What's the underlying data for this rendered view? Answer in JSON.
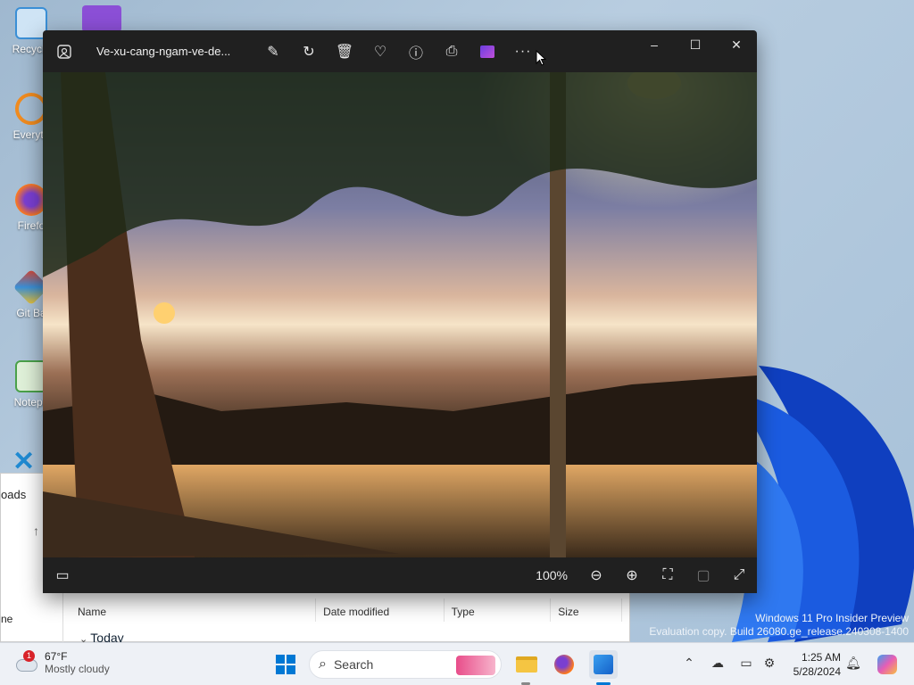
{
  "desktop": {
    "icons": [
      {
        "label": "Recycle",
        "color": "#3a8fd6"
      },
      {
        "label": "Everyth",
        "color": "#f08b1f"
      },
      {
        "label": "Firefo",
        "color": "#e8552f"
      },
      {
        "label": "Git Ba",
        "color": "#e0412a"
      },
      {
        "label": "Notepa",
        "color": "#4aa14a"
      }
    ]
  },
  "explorer": {
    "title": "oads",
    "left_item": "ne",
    "columns": [
      "Name",
      "Date modified",
      "Type",
      "Size"
    ],
    "group": "Today"
  },
  "photos": {
    "filename": "Ve-xu-cang-ngam-ve-de...",
    "toolbar": [
      "edit-icon",
      "rotate-icon",
      "delete-icon",
      "favorite-icon",
      "info-icon",
      "print-icon",
      "clipchamp-icon",
      "more-icon"
    ],
    "zoom": "100%"
  },
  "watermark": {
    "line1": "Windows 11 Pro Insider Preview",
    "line2": "Evaluation copy. Build 26080.ge_release.240308-1400"
  },
  "taskbar": {
    "weather_badge": "1",
    "temp": "67°F",
    "condition": "Mostly cloudy",
    "search_label": "Search",
    "time": "1:25 AM",
    "date": "5/28/2024"
  },
  "colors": {
    "accent": "#0078d4",
    "photos_bg": "#202020"
  }
}
